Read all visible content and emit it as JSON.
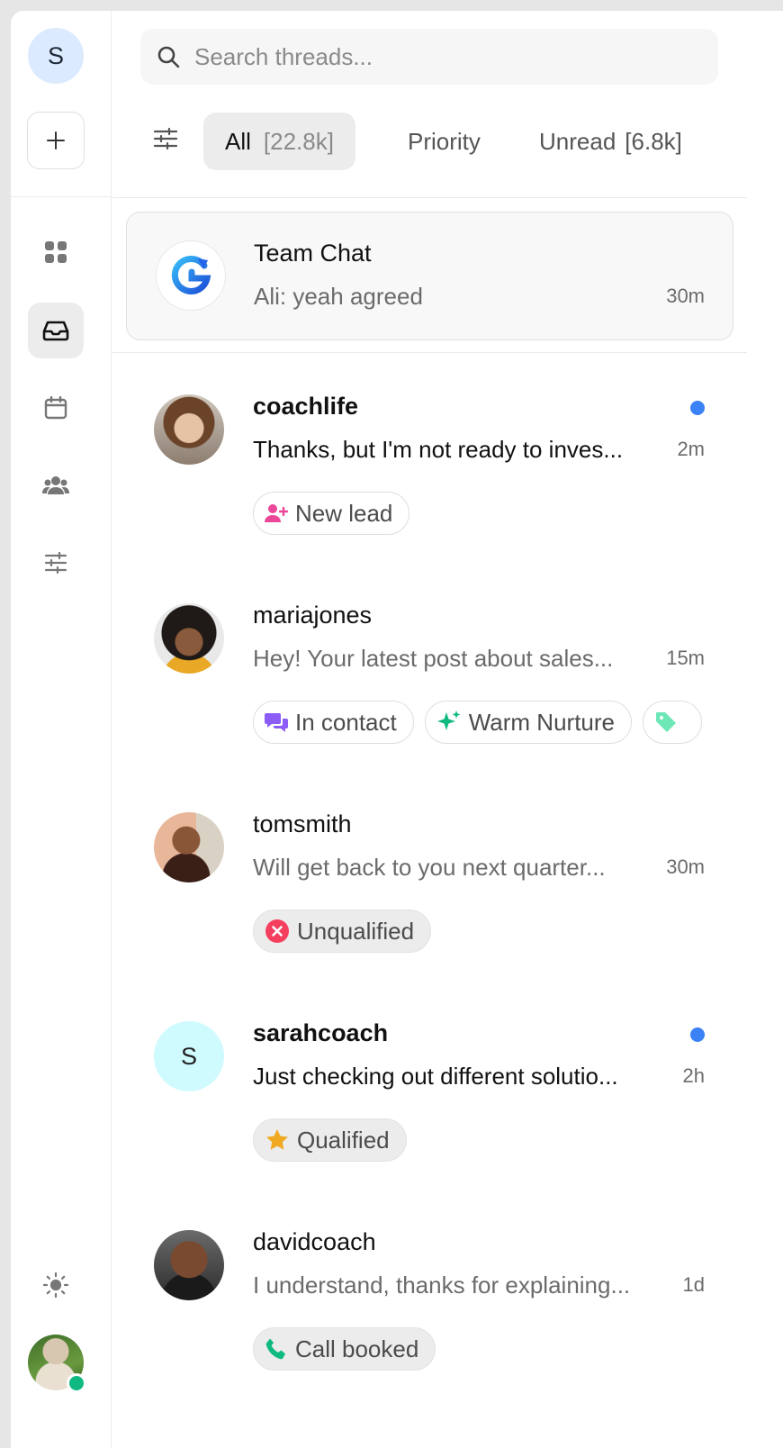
{
  "rail": {
    "workspace_initial": "S",
    "nav": [
      {
        "icon": "grid-icon",
        "active": false
      },
      {
        "icon": "inbox-icon",
        "active": true
      },
      {
        "icon": "calendar-icon",
        "active": false
      },
      {
        "icon": "people-icon",
        "active": false
      },
      {
        "icon": "sliders-icon",
        "active": false
      }
    ],
    "bottom": [
      "sun-icon",
      "user-avatar"
    ],
    "online_color": "#10b981"
  },
  "search": {
    "placeholder": "Search threads..."
  },
  "tabs": [
    {
      "label": "All",
      "count": "[22.8k]",
      "active": true
    },
    {
      "label": "Priority",
      "count": "",
      "active": false
    },
    {
      "label": "Unread",
      "count": "[6.8k]",
      "active": false
    }
  ],
  "team_chat": {
    "name": "Team Chat",
    "last_message": "Ali: yeah agreed",
    "time": "30m"
  },
  "threads": [
    {
      "name": "coachlife",
      "message": "Thanks, but I'm not ready to inves...",
      "time": "2m",
      "unread": true,
      "tags": [
        {
          "label": "New lead",
          "icon": "user-plus-icon"
        }
      ]
    },
    {
      "name": "mariajones",
      "message": "Hey! Your latest post about sales...",
      "time": "15m",
      "unread": false,
      "tags": [
        {
          "label": "In contact",
          "icon": "chat-bubbles-icon"
        },
        {
          "label": "Warm Nurture",
          "icon": "sparkles-icon"
        },
        {
          "label": "",
          "icon": "tag-icon"
        }
      ]
    },
    {
      "name": "tomsmith",
      "message": "Will get back to you next quarter...",
      "time": "30m",
      "unread": false,
      "tags": [
        {
          "label": "Unqualified",
          "icon": "x-circle-icon"
        }
      ]
    },
    {
      "name": "sarahcoach",
      "initial": "S",
      "message": "Just checking out different solutio...",
      "time": "2h",
      "unread": true,
      "tags": [
        {
          "label": "Qualified",
          "icon": "star-icon"
        }
      ]
    },
    {
      "name": "davidcoach",
      "message": "I understand, thanks for explaining...",
      "time": "1d",
      "unread": false,
      "tags": [
        {
          "label": "Call booked",
          "icon": "phone-icon"
        }
      ]
    }
  ],
  "colors": {
    "accent": "#3b82f6",
    "unread_dot": "#3b82f6"
  }
}
